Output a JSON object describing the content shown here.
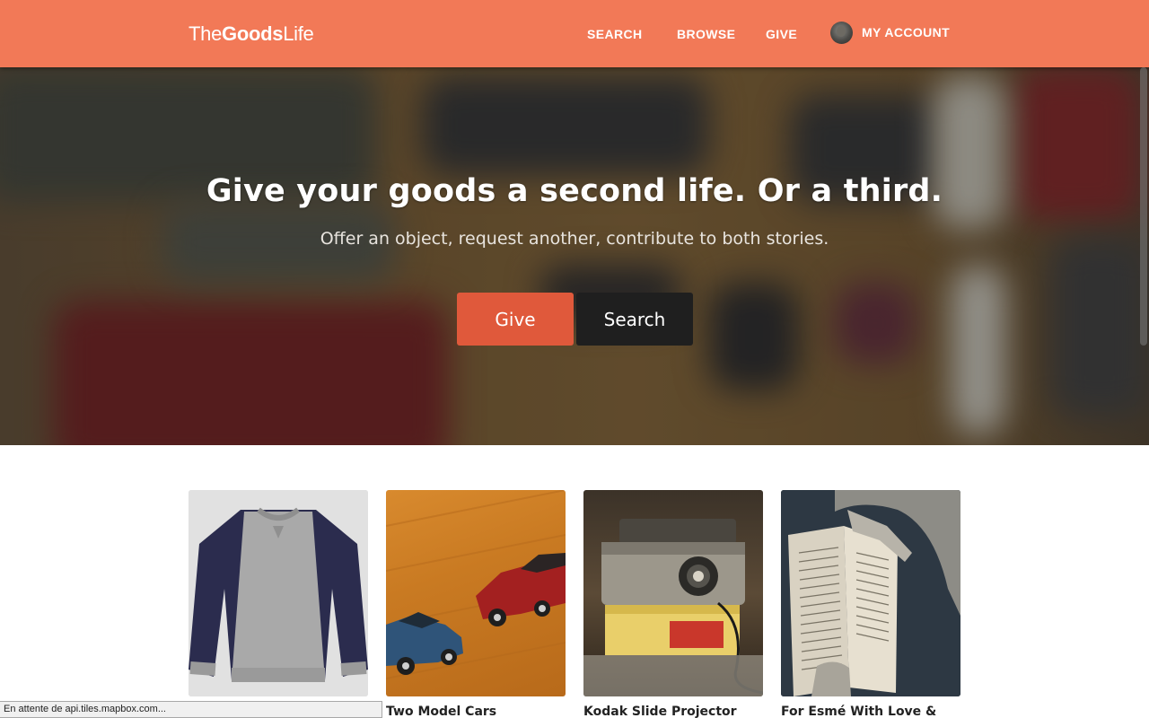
{
  "header": {
    "logo": {
      "the": "The",
      "goods": "Goods",
      "life": "Life"
    },
    "nav": {
      "search": "SEARCH",
      "browse": "BROWSE",
      "give": "GIVE",
      "account": "MY ACCOUNT"
    }
  },
  "hero": {
    "title": "Give your goods a second life. Or a third.",
    "subtitle": "Offer an object, request another, contribute to both stories.",
    "give_button": "Give",
    "search_button": "Search"
  },
  "cards": [
    {
      "title": "",
      "image": "sweater"
    },
    {
      "title": "Two Model Cars",
      "image": "model-cars"
    },
    {
      "title": "Kodak Slide Projector",
      "image": "slide-projector"
    },
    {
      "title": "For Esmé With Love &",
      "image": "book"
    }
  ],
  "status_bar": {
    "text": "En attente de api.tiles.mapbox.com..."
  },
  "colors": {
    "header": "#f27957",
    "give_button": "#e0593b",
    "search_button": "#1f1f1f"
  }
}
